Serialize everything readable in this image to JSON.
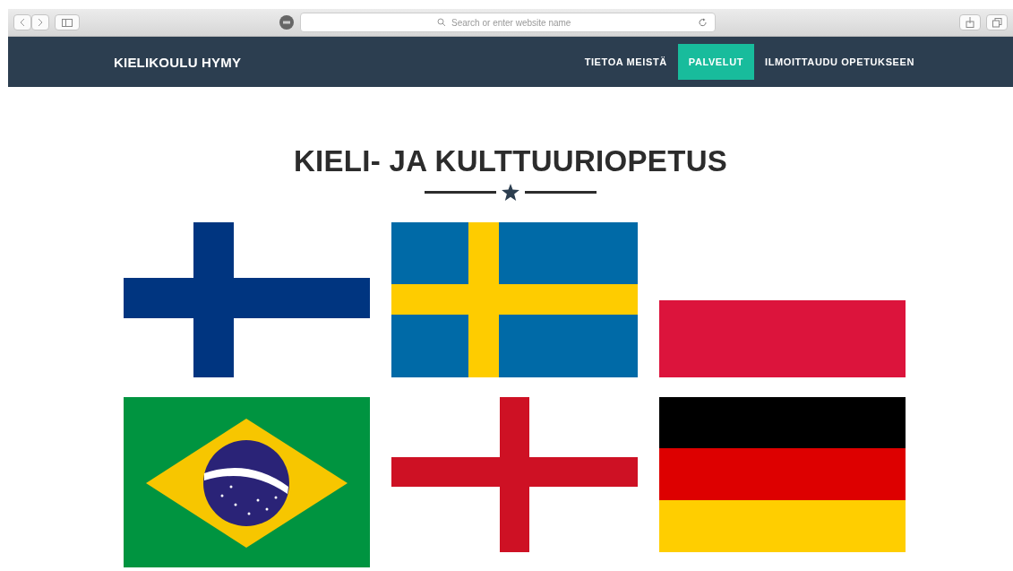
{
  "browser": {
    "address_placeholder": "Search or enter website name"
  },
  "nav": {
    "brand": "KIELIKOULU HYMY",
    "items": [
      {
        "label": "TIETOA MEISTÄ",
        "selected": false
      },
      {
        "label": "PALVELUT",
        "selected": true
      },
      {
        "label": "ILMOITTAUDU OPETUKSEEN",
        "selected": false
      }
    ]
  },
  "heading": "KIELI- JA KULTTUURIOPETUS",
  "flags": [
    {
      "kind": "nordic-blue"
    },
    {
      "kind": "nordic-yellow"
    },
    {
      "kind": "white-red"
    },
    {
      "kind": "diamond"
    },
    {
      "kind": "red-cross"
    },
    {
      "kind": "tricolor"
    }
  ]
}
